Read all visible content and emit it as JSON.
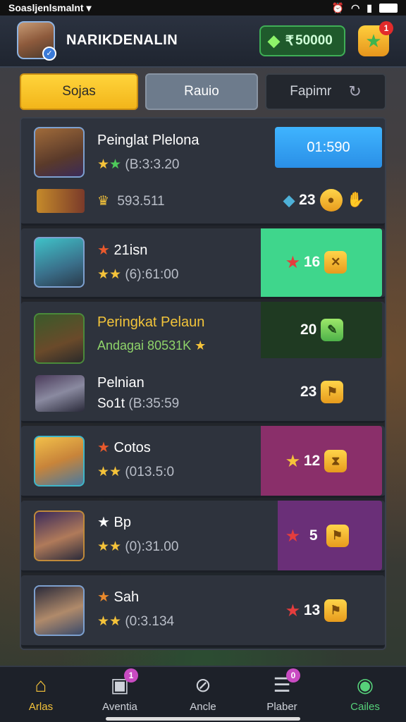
{
  "status_bar": {
    "carrier": "Soasljenlsmalnt ▾"
  },
  "header": {
    "player_name": "NARIKDENALIN",
    "currency_value": "50000",
    "currency_prefix": "₹",
    "star_badge": "1"
  },
  "tabs": [
    {
      "label": "Sojas",
      "active": true
    },
    {
      "label": "Rauio",
      "active": false
    },
    {
      "label": "Fapimr",
      "active": false
    }
  ],
  "rows": [
    {
      "name": "Peinglat Plelona",
      "sub_time": "(B:3:3.20",
      "timer_label": "01:590",
      "reward_text": "593.511",
      "score": "23",
      "accent": ""
    },
    {
      "name": "21isn",
      "sub_time": "(6):61:00",
      "score": "16",
      "accent": "#3fd68c"
    },
    {
      "name": "Peringkat Pelaun",
      "sub_time": "Andagai 80531K",
      "score": "20",
      "accent": "#1f3a22"
    },
    {
      "name": "Pelnian",
      "sub_label": "So1t",
      "sub_time": "(B:35:59",
      "score": "23",
      "accent": ""
    },
    {
      "name": "Cotos",
      "sub_time": "(013.5:0",
      "score": "12",
      "accent": "#8a2f6a"
    },
    {
      "name": "Bp",
      "sub_time": "(0):31.00",
      "score": "5",
      "accent": "#6a2f78"
    },
    {
      "name": "Sah",
      "sub_time": "(0:3.134",
      "score": "13",
      "accent": ""
    }
  ],
  "bottom_nav": [
    {
      "label": "Arlas",
      "icon": "home-icon",
      "active": true
    },
    {
      "label": "Aventia",
      "icon": "scoreboard-icon",
      "badge": "1"
    },
    {
      "label": "Ancle",
      "icon": "compass-icon"
    },
    {
      "label": "Plaber",
      "icon": "inbox-icon",
      "badge": "0"
    },
    {
      "label": "Cailes",
      "icon": "globe-icon"
    }
  ]
}
